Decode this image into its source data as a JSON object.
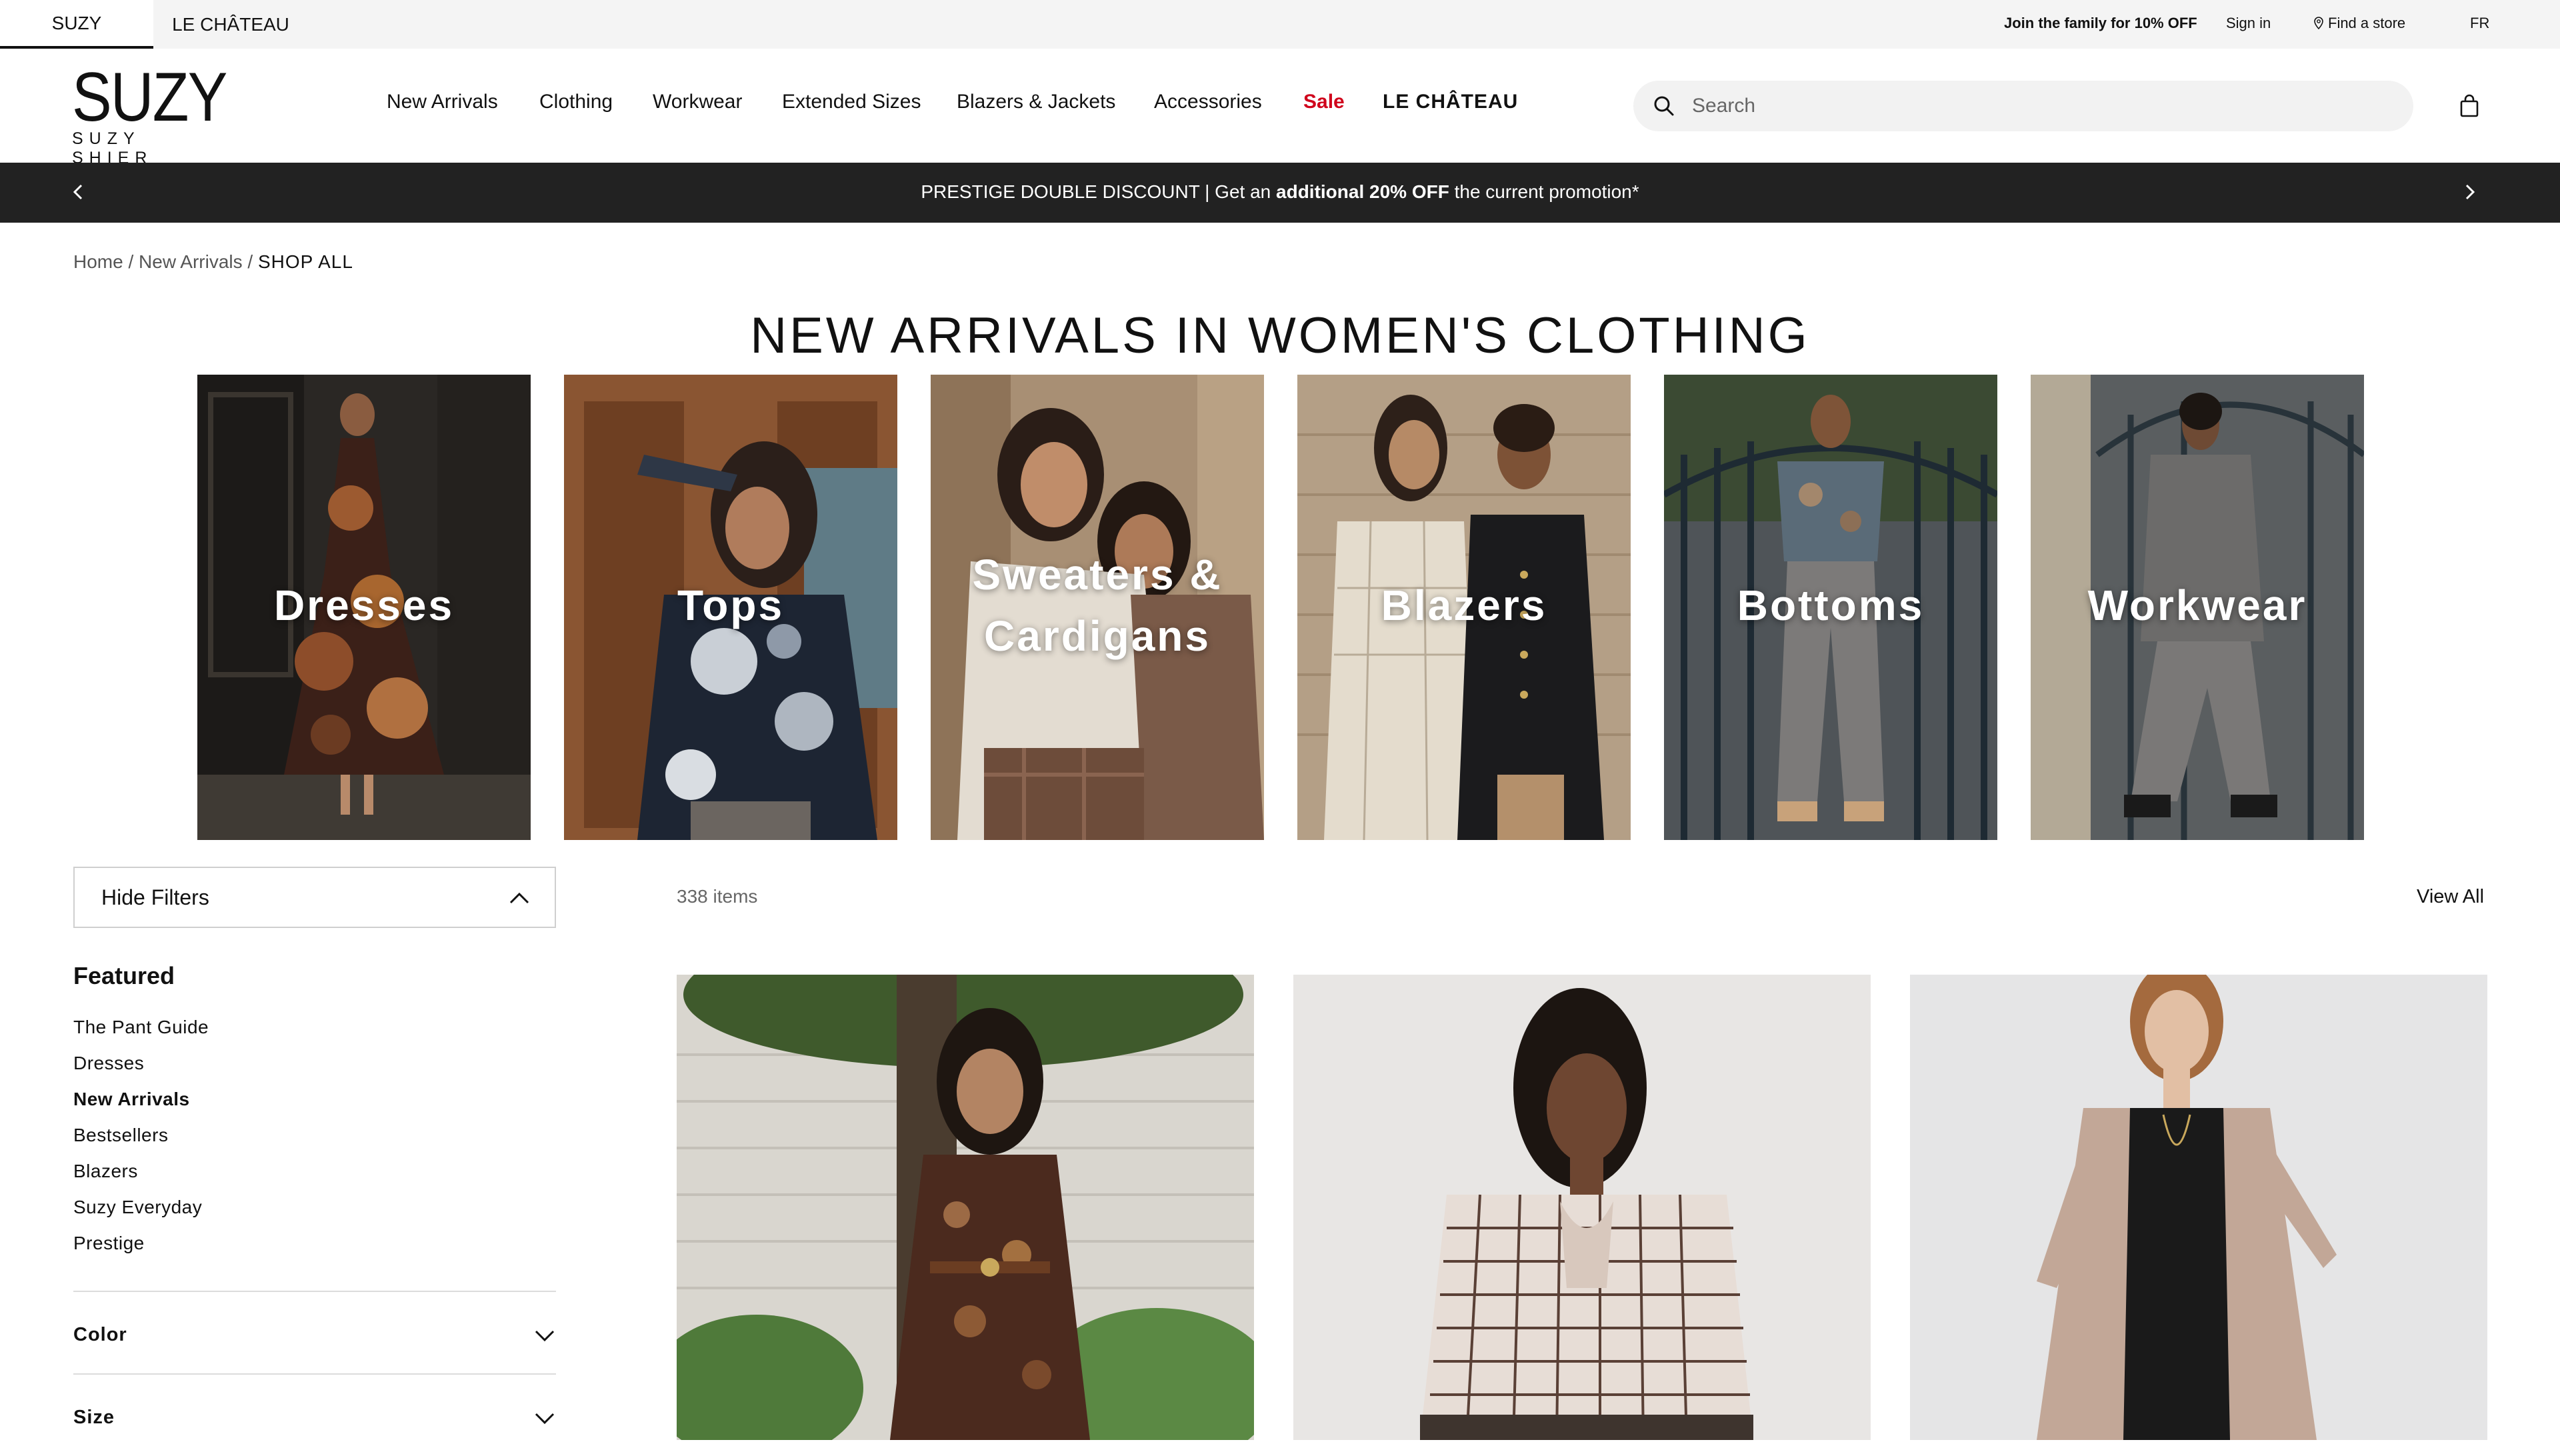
{
  "utility_bar": {
    "brand_tabs": [
      "SUZY",
      "LE CHÂTEAU"
    ],
    "join_text": "Join the family for 10% OFF",
    "sign_in": "Sign in",
    "find_store": "Find a store",
    "language": "FR"
  },
  "header": {
    "logo_main": "SUZY",
    "logo_sub": "SUZY SHIER",
    "nav": [
      "New Arrivals",
      "Clothing",
      "Workwear",
      "Extended Sizes",
      "Blazers & Jackets",
      "Accessories",
      "Sale",
      "LE CHÂTEAU"
    ],
    "search_placeholder": "Search"
  },
  "promo": {
    "text_before": "PRESTIGE DOUBLE DISCOUNT | Get an ",
    "text_bold": "additional 20% OFF",
    "text_after": " the current promotion*"
  },
  "breadcrumb": {
    "home": "Home",
    "sep1": " / ",
    "parent": "New Arrivals",
    "sep2": " / ",
    "current": "SHOP ALL"
  },
  "page_title": "NEW ARRIVALS IN WOMEN'S CLOTHING",
  "categories": [
    {
      "line1": "Dresses",
      "line2": ""
    },
    {
      "line1": "Tops",
      "line2": ""
    },
    {
      "line1": "Sweaters &",
      "line2": "Cardigans"
    },
    {
      "line1": "Blazers",
      "line2": ""
    },
    {
      "line1": "Bottoms",
      "line2": ""
    },
    {
      "line1": "Workwear",
      "line2": ""
    }
  ],
  "filters": {
    "toggle_label": "Hide Filters",
    "featured_title": "Featured",
    "featured_items": [
      "The Pant Guide",
      "Dresses",
      "New Arrivals",
      "Bestsellers",
      "Blazers",
      "Suzy Everyday",
      "Prestige"
    ],
    "active_featured": "New Arrivals",
    "groups": [
      "Color",
      "Size"
    ]
  },
  "results": {
    "count": "338 items",
    "view_all": "View All"
  },
  "colors": {
    "sale": "#d0021b",
    "promo_bg": "#222222",
    "utility_bg": "#f4f4f4"
  }
}
